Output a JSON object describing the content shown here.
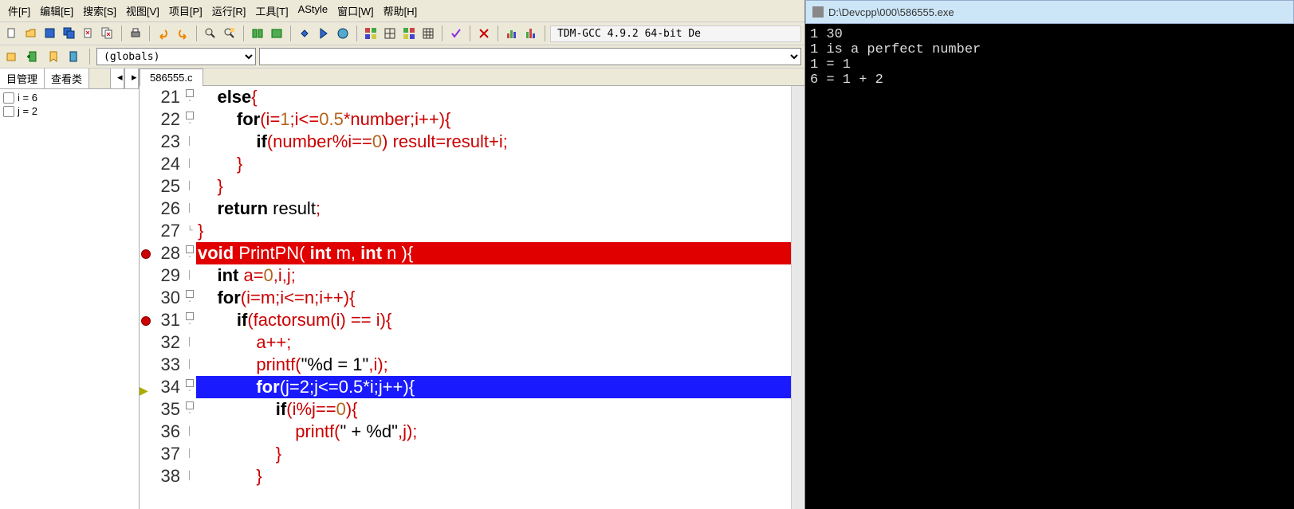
{
  "menu": [
    "件[F]",
    "编辑[E]",
    "搜索[S]",
    "视图[V]",
    "项目[P]",
    "运行[R]",
    "工具[T]",
    "AStyle",
    "窗口[W]",
    "帮助[H]"
  ],
  "compiler_label": "TDM-GCC 4.9.2 64-bit De",
  "globals_combo": "(globals)",
  "left_tabs": [
    "目管理",
    "查看类"
  ],
  "watch": [
    {
      "expr": "i = 6"
    },
    {
      "expr": "j = 2"
    }
  ],
  "file_tab": "586555.c",
  "lines": [
    {
      "n": "21",
      "fold": "open",
      "cls": "",
      "segs": [
        {
          "t": "    ",
          "c": ""
        },
        {
          "t": "else",
          "c": "kw"
        },
        {
          "t": "{",
          "c": "op"
        }
      ]
    },
    {
      "n": "22",
      "fold": "open",
      "cls": "",
      "segs": [
        {
          "t": "        ",
          "c": ""
        },
        {
          "t": "for",
          "c": "kw"
        },
        {
          "t": "(i=",
          "c": "op"
        },
        {
          "t": "1",
          "c": "num"
        },
        {
          "t": ";i<=",
          "c": "op"
        },
        {
          "t": "0.5",
          "c": "num"
        },
        {
          "t": "*number;i++){",
          "c": "op"
        }
      ]
    },
    {
      "n": "23",
      "fold": "",
      "cls": "",
      "segs": [
        {
          "t": "            ",
          "c": ""
        },
        {
          "t": "if",
          "c": "kw"
        },
        {
          "t": "(number%i==",
          "c": "op"
        },
        {
          "t": "0",
          "c": "num"
        },
        {
          "t": ") result=result+i;",
          "c": "op"
        }
      ]
    },
    {
      "n": "24",
      "fold": "",
      "cls": "",
      "segs": [
        {
          "t": "        ",
          "c": ""
        },
        {
          "t": "}",
          "c": "op"
        }
      ]
    },
    {
      "n": "25",
      "fold": "",
      "cls": "",
      "segs": [
        {
          "t": "    ",
          "c": ""
        },
        {
          "t": "}",
          "c": "op"
        }
      ]
    },
    {
      "n": "26",
      "fold": "",
      "cls": "",
      "segs": [
        {
          "t": "    ",
          "c": ""
        },
        {
          "t": "return",
          "c": "kw"
        },
        {
          "t": " result",
          "": ""
        },
        {
          "t": ";",
          "c": "op"
        }
      ]
    },
    {
      "n": "27",
      "fold": "close",
      "cls": "",
      "segs": [
        {
          "t": "}",
          "c": "op"
        }
      ]
    },
    {
      "n": "28",
      "fold": "open",
      "cls": "ln-hl-red",
      "marker": "bp",
      "segs": [
        {
          "t": "void",
          "c": "kw"
        },
        {
          "t": " PrintPN( ",
          "c": ""
        },
        {
          "t": "int",
          "c": "kw"
        },
        {
          "t": " m, ",
          "c": ""
        },
        {
          "t": "int",
          "c": "kw"
        },
        {
          "t": " n ){",
          "c": ""
        }
      ]
    },
    {
      "n": "29",
      "fold": "",
      "cls": "",
      "segs": [
        {
          "t": "    ",
          "c": ""
        },
        {
          "t": "int",
          "c": "kw"
        },
        {
          "t": " a=",
          "c": "op"
        },
        {
          "t": "0",
          "c": "num"
        },
        {
          "t": ",i,j;",
          "c": "op"
        }
      ]
    },
    {
      "n": "30",
      "fold": "open",
      "cls": "",
      "segs": [
        {
          "t": "    ",
          "c": ""
        },
        {
          "t": "for",
          "c": "kw"
        },
        {
          "t": "(i=m;i<=n;i++){",
          "c": "op"
        }
      ]
    },
    {
      "n": "31",
      "fold": "open",
      "cls": "",
      "marker": "bp",
      "segs": [
        {
          "t": "        ",
          "c": ""
        },
        {
          "t": "if",
          "c": "kw"
        },
        {
          "t": "(factorsum(i) == i){",
          "c": "op"
        }
      ]
    },
    {
      "n": "32",
      "fold": "",
      "cls": "",
      "segs": [
        {
          "t": "            a++;",
          "c": "op"
        }
      ]
    },
    {
      "n": "33",
      "fold": "",
      "cls": "",
      "segs": [
        {
          "t": "            printf(",
          "c": "op"
        },
        {
          "t": "\"%d = 1\"",
          "c": "str"
        },
        {
          "t": ",i);",
          "c": "op"
        }
      ]
    },
    {
      "n": "34",
      "fold": "open",
      "cls": "ln-hl-blue",
      "marker": "arrow",
      "segs": [
        {
          "t": "            ",
          "c": ""
        },
        {
          "t": "for",
          "c": "kw"
        },
        {
          "t": "(j=",
          "c": ""
        },
        {
          "t": "2",
          "c": ""
        },
        {
          "t": ";j<=",
          "c": ""
        },
        {
          "t": "0.5",
          "c": ""
        },
        {
          "t": "*i;j++){",
          "c": ""
        }
      ]
    },
    {
      "n": "35",
      "fold": "open",
      "cls": "",
      "segs": [
        {
          "t": "                ",
          "c": ""
        },
        {
          "t": "if",
          "c": "kw"
        },
        {
          "t": "(i%j==",
          "c": "op"
        },
        {
          "t": "0",
          "c": "num"
        },
        {
          "t": "){",
          "c": "op"
        }
      ]
    },
    {
      "n": "36",
      "fold": "",
      "cls": "",
      "segs": [
        {
          "t": "                    printf(",
          "c": "op"
        },
        {
          "t": "\" + %d\"",
          "c": "str"
        },
        {
          "t": ",j);",
          "c": "op"
        }
      ]
    },
    {
      "n": "37",
      "fold": "",
      "cls": "",
      "segs": [
        {
          "t": "                ",
          "c": ""
        },
        {
          "t": "}",
          "c": "op"
        }
      ]
    },
    {
      "n": "38",
      "fold": "",
      "cls": "",
      "segs": [
        {
          "t": "            ",
          "c": ""
        },
        {
          "t": "}",
          "c": "op"
        }
      ]
    }
  ],
  "console": {
    "title": "D:\\Devcpp\\000\\586555.exe",
    "output": "1 30\n1 is a perfect number\n1 = 1\n6 = 1 + 2"
  }
}
